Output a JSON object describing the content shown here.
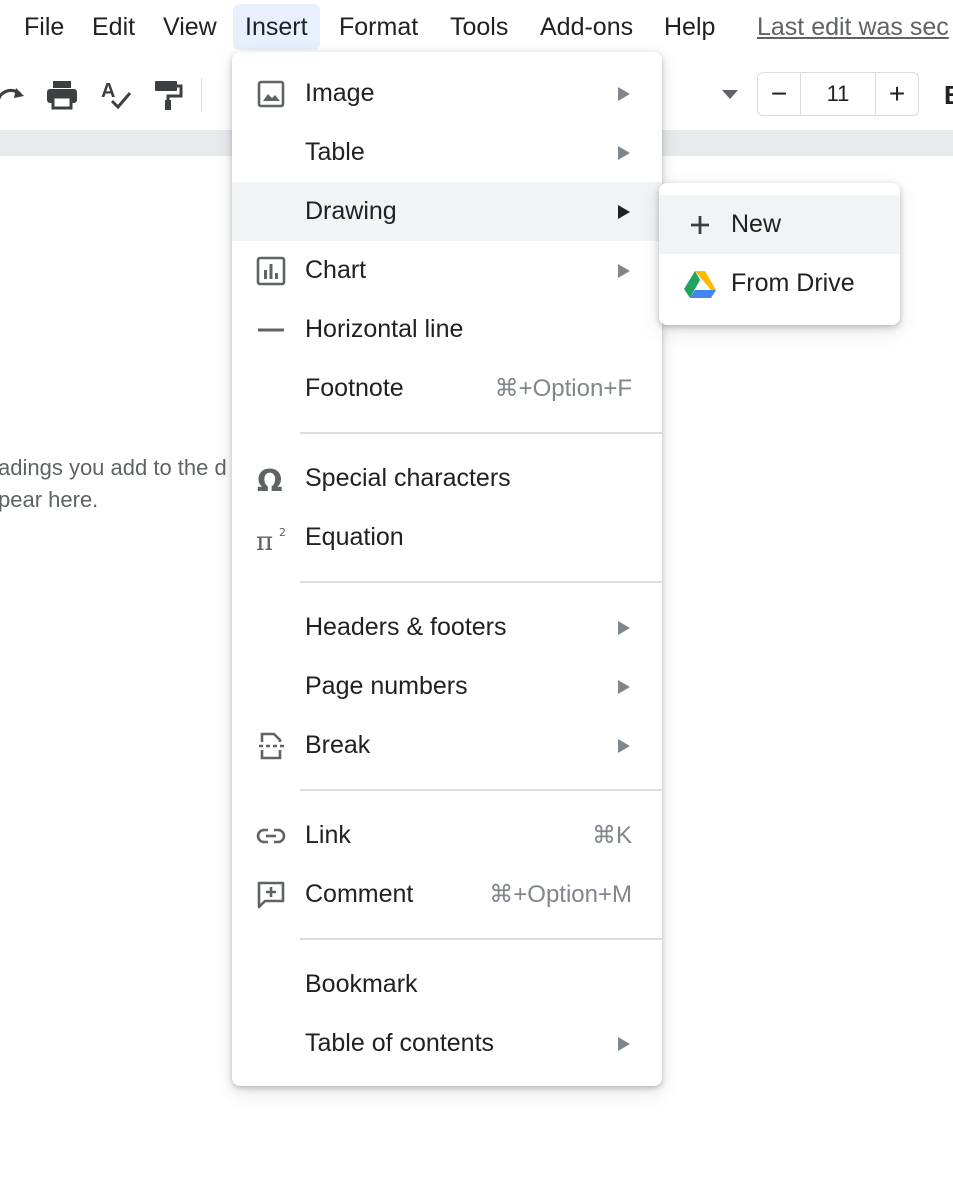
{
  "menubar": {
    "items": [
      {
        "label": "File"
      },
      {
        "label": "Edit"
      },
      {
        "label": "View"
      },
      {
        "label": "Insert"
      },
      {
        "label": "Format"
      },
      {
        "label": "Tools"
      },
      {
        "label": "Add-ons"
      },
      {
        "label": "Help"
      }
    ],
    "last_edit": "Last edit was sec"
  },
  "toolbar": {
    "icons": [
      "redo-icon",
      "print-icon",
      "spellcheck-icon",
      "paint-format-icon"
    ],
    "font_size_minus": "−",
    "font_size": "11",
    "font_size_plus": "+",
    "bold_fragment": "B"
  },
  "document": {
    "outline_line1": "adings you add to the d",
    "outline_line2": "pear here."
  },
  "insert_menu": {
    "items": [
      {
        "label": "Image",
        "icon": "image-icon",
        "submenu": true
      },
      {
        "label": "Table",
        "submenu": true
      },
      {
        "label": "Drawing",
        "submenu": true,
        "highlighted": true
      },
      {
        "label": "Chart",
        "icon": "chart-icon",
        "submenu": true
      },
      {
        "label": "Horizontal line",
        "icon": "horizontal-line-icon"
      },
      {
        "label": "Footnote",
        "shortcut": "⌘+Option+F"
      },
      {
        "label": "Special characters",
        "icon": "omega-icon"
      },
      {
        "label": "Equation",
        "icon": "pi-icon"
      },
      {
        "label": "Headers & footers",
        "submenu": true
      },
      {
        "label": "Page numbers",
        "submenu": true
      },
      {
        "label": "Break",
        "icon": "page-break-icon",
        "submenu": true
      },
      {
        "label": "Link",
        "icon": "link-icon",
        "shortcut": "⌘K"
      },
      {
        "label": "Comment",
        "icon": "add-comment-icon",
        "shortcut": "⌘+Option+M"
      },
      {
        "label": "Bookmark"
      },
      {
        "label": "Table of contents",
        "submenu": true
      }
    ]
  },
  "drawing_submenu": {
    "items": [
      {
        "label": "New",
        "icon": "plus-icon",
        "highlighted": true
      },
      {
        "label": "From Drive",
        "icon": "google-drive-icon"
      }
    ]
  },
  "colors": {
    "active_menubar_bg": "#e8f0fe",
    "hover_bg": "#f1f3f4",
    "text": "#202124",
    "muted": "#80868b",
    "drive_green": "#1ea362",
    "drive_yellow": "#ffba00",
    "drive_blue": "#4285f4"
  }
}
